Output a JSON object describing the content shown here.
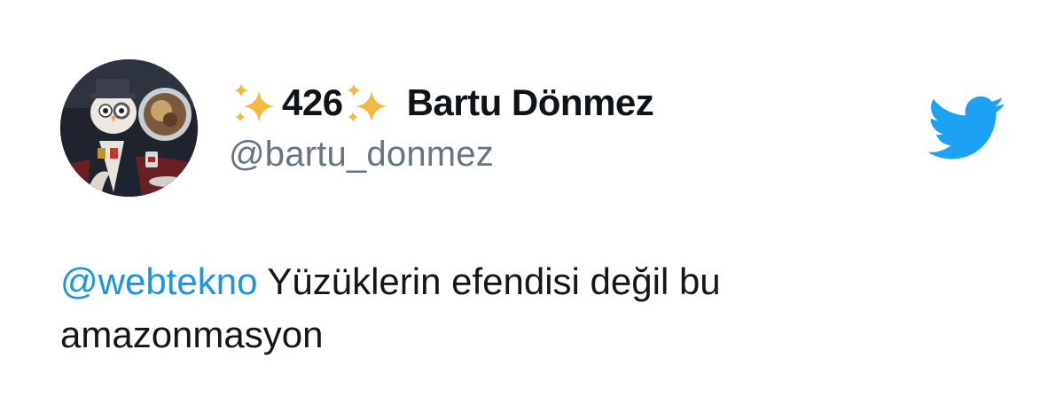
{
  "tweet": {
    "author": {
      "name_prefix_icon": "sparkles-icon",
      "name_number": "426",
      "name_suffix_icon": "sparkles-icon",
      "name": "Bartu Dönmez",
      "handle": "@bartu_donmez",
      "avatar_icon": "owl-avatar"
    },
    "brand_icon": "twitter-bird-icon",
    "text": {
      "mention": "@webtekno",
      "body_line1": " Yüzüklerin efendisi değil bu",
      "body_line2": "amazonmasyon"
    }
  },
  "colors": {
    "mention": "#1b95e0",
    "handle": "#66757f",
    "text": "#14171a",
    "twitter_brand": "#1da1f2",
    "sparkle": "#f5b841"
  }
}
